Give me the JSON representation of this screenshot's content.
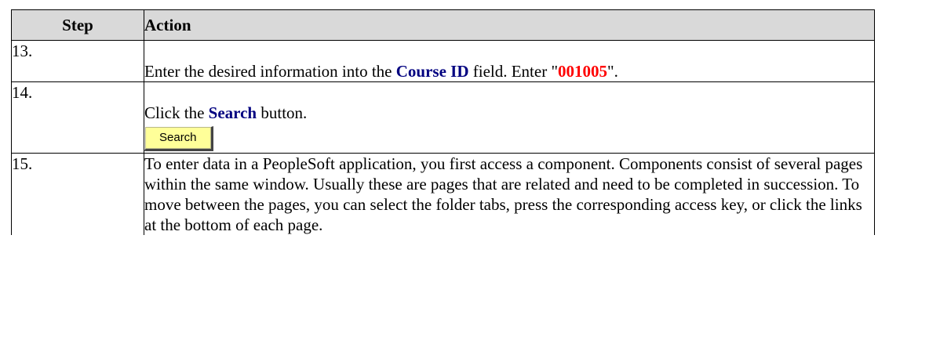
{
  "header": {
    "step": "Step",
    "action": "Action"
  },
  "rows": [
    {
      "step": "13.",
      "t1": "Enter the desired information into the ",
      "field": "Course ID",
      "t2": " field. Enter \"",
      "value": "001005",
      "t3": "\"."
    },
    {
      "step": "14.",
      "t1": "Click the ",
      "button_name": "Search",
      "t2": " button.",
      "button_label": "Search"
    },
    {
      "step": "15.",
      "text": "To enter data in a PeopleSoft application, you first access a component. Components consist of several pages within the same window.  Usually these are pages that are related and need to be completed in succession.  To move between the pages, you can select the folder tabs, press the corresponding access key, or click the links at the bottom of each page."
    }
  ],
  "colors": {
    "header_bg": "#d9d9d9",
    "field_name": "#000080",
    "entered_value": "#ff0000",
    "button_bg": "#ffff99"
  }
}
